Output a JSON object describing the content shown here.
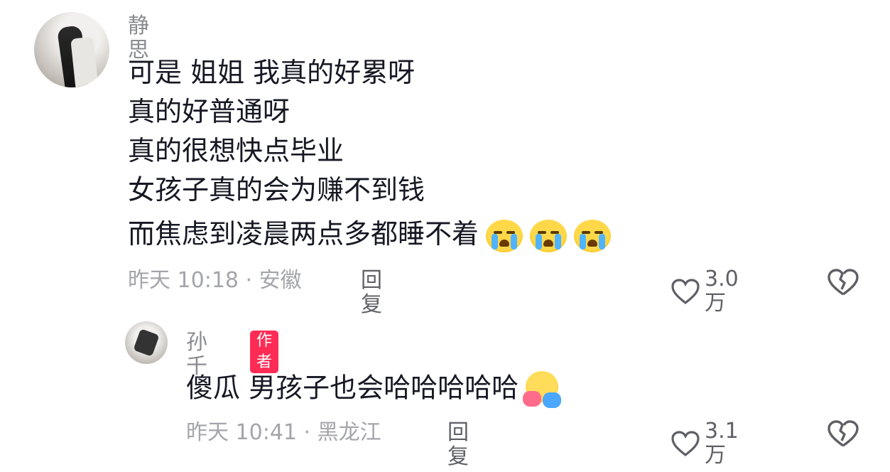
{
  "comment": {
    "username": "静思",
    "lines": [
      "可是 姐姐 我真的好累呀",
      " 真的好普通呀",
      "真的很想快点毕业",
      "女孩子真的会为赚不到钱",
      "而焦虑到凌晨两点多都睡不着"
    ],
    "emoji": "loudly-crying-face x3",
    "meta": "昨天 10:18 · 安徽",
    "reply_label": "回复",
    "likes": "3.0万"
  },
  "reply": {
    "username": "孙千",
    "badge": "作者",
    "text": "傻瓜 男孩子也会哈哈哈哈哈",
    "emoji": "hugging-face",
    "meta": "昨天 10:41 · 黑龙江",
    "reply_label": "回复",
    "likes": "3.1万"
  },
  "colors": {
    "badge": "#fe2c55",
    "meta": "#a4a5aa",
    "text": "#161823"
  }
}
